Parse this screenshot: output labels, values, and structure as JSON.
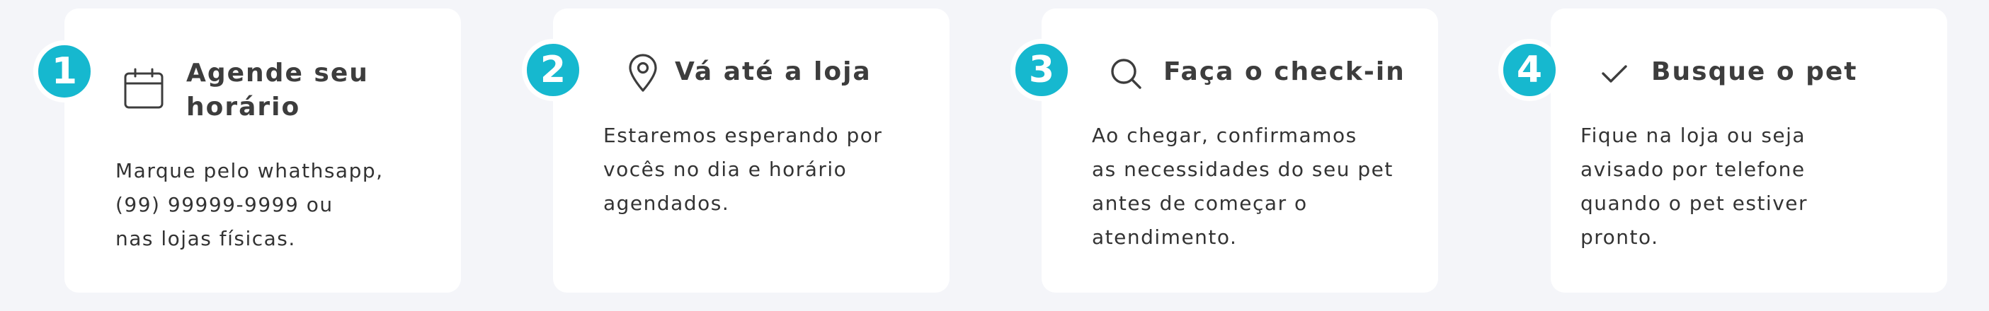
{
  "steps": [
    {
      "number": "1",
      "icon": "calendar-icon",
      "title_line1": "Agende seu",
      "title_line2": "horário",
      "desc_lines": [
        "Marque pelo whathsapp,",
        "(99) 99999-9999 ou",
        "nas lojas físicas."
      ]
    },
    {
      "number": "2",
      "icon": "map-pin-icon",
      "title_line1": "Vá até a loja",
      "desc_lines": [
        "Estaremos esperando por",
        "vocês no dia e horário",
        "agendados."
      ]
    },
    {
      "number": "3",
      "icon": "search-icon",
      "title_line1": "Faça o check-in",
      "desc_lines": [
        "Ao chegar, confirmamos",
        "as necessidades do seu pet",
        "antes de começar o",
        "atendimento."
      ]
    },
    {
      "number": "4",
      "icon": "check-icon",
      "title_line1": "Busque o pet",
      "desc_lines": [
        "Fique na loja ou seja",
        "avisado por telefone",
        "quando o pet estiver",
        "pronto."
      ]
    }
  ],
  "colors": {
    "accent": "#16b8cf",
    "background": "#f4f5f9",
    "card": "#ffffff",
    "text": "#333333"
  }
}
